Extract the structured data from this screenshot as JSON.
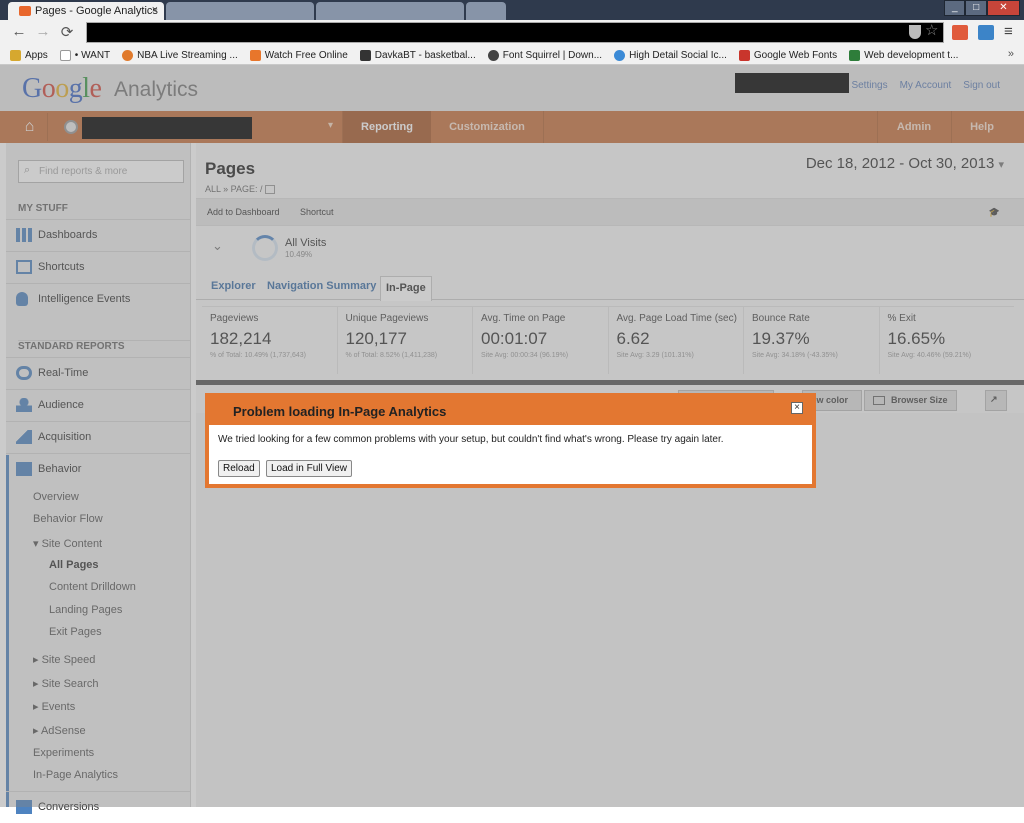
{
  "browser": {
    "tabs": [
      {
        "title": "Pages - Google Analytics",
        "active": true
      },
      {
        "title": "",
        "active": false
      },
      {
        "title": "",
        "active": false
      },
      {
        "title": "",
        "active": false
      }
    ],
    "close_glyph": "×",
    "window_buttons": {
      "minimize": "_",
      "maximize": "□",
      "close": "✕"
    },
    "back_glyph": "←",
    "forward_glyph": "→",
    "reload_glyph": "⟳",
    "star_glyph": "☆",
    "menu_glyph": "≡",
    "bookmarks": [
      {
        "label": "Apps",
        "color": "#d6a82f"
      },
      {
        "label": "• WANT",
        "color": "#ffffff"
      },
      {
        "label": "NBA Live Streaming ...",
        "color": "#e07a2c"
      },
      {
        "label": "Watch Free Online",
        "color": "#e8762b"
      },
      {
        "label": "DavkaBT - basketbal...",
        "color": "#333333"
      },
      {
        "label": "Font Squirrel | Down...",
        "color": "#444444"
      },
      {
        "label": "High Detail Social Ic...",
        "color": "#3b8ad6"
      },
      {
        "label": "Google Web Fonts",
        "color": "#c9352c"
      },
      {
        "label": "Web development t...",
        "color": "#2e7d3a"
      }
    ],
    "bookmarks_more": "»"
  },
  "header": {
    "logo_word": "Google",
    "product": "Analytics",
    "links": [
      "Settings",
      "My Account",
      "Sign out"
    ]
  },
  "nav": {
    "home_glyph": "⌂",
    "dropdown_glyph": "▾",
    "tabs": [
      "Reporting",
      "Customization"
    ],
    "right": [
      "Admin",
      "Help"
    ]
  },
  "sidebar": {
    "search_placeholder": "Find reports & more",
    "search_glyph": "⌕",
    "my_stuff_heading": "MY STUFF",
    "my_stuff": [
      "Dashboards",
      "Shortcuts",
      "Intelligence Events"
    ],
    "standard_heading": "STANDARD REPORTS",
    "standard": [
      "Real-Time",
      "Audience",
      "Acquisition",
      "Behavior"
    ],
    "behavior_items": [
      "Overview",
      "Behavior Flow",
      "▾ Site Content",
      "All Pages",
      "Content Drilldown",
      "Landing Pages",
      "Exit Pages",
      "▸ Site Speed",
      "▸ Site Search",
      "▸ Events",
      "▸ AdSense",
      "Experiments",
      "In-Page Analytics"
    ],
    "conversions": "Conversions",
    "icon_color": "#4e83c0"
  },
  "main": {
    "title": "Pages",
    "breadcrumb": "ALL  »  PAGE: /",
    "date_range": "Dec 18, 2012 - Oct 30, 2013",
    "date_caret": "▾",
    "actions": [
      "Add to Dashboard",
      "Shortcut"
    ],
    "segment": {
      "name": "All Visits",
      "pct": "10.49%",
      "chevron": "⌄"
    },
    "tabs": [
      "Explorer",
      "Navigation Summary",
      "In-Page"
    ],
    "metrics": [
      {
        "label": "Pageviews",
        "value": "182,214",
        "sub": "% of Total: 10.49% (1,737,643)"
      },
      {
        "label": "Unique Pageviews",
        "value": "120,177",
        "sub": "% of Total: 8.52% (1,411,238)"
      },
      {
        "label": "Avg. Time on Page",
        "value": "00:01:07",
        "sub": "Site Avg: 00:00:34 (96.19%)"
      },
      {
        "label": "Avg. Page Load Time (sec)",
        "value": "6.62",
        "sub": "Site Avg: 3.29 (101.31%)"
      },
      {
        "label": "Bounce Rate",
        "value": "19.37%",
        "sub": "Site Avg: 34.18% (-43.35%)"
      },
      {
        "label": "% Exit",
        "value": "16.65%",
        "sub": "Site Avg: 40.46% (59.21%)"
      }
    ],
    "controls": {
      "show_color": "ow color",
      "browser_size": "Browser Size",
      "expand_glyph": "↗"
    },
    "accent": "#c6713d"
  },
  "dialog": {
    "title": "Problem loading In-Page Analytics",
    "message": "We tried looking for a few common problems with your setup, but couldn't find what's wrong. Please try again later.",
    "buttons": [
      "Reload",
      "Load in Full View"
    ],
    "close_glyph": "×",
    "border_color": "#e37731"
  }
}
